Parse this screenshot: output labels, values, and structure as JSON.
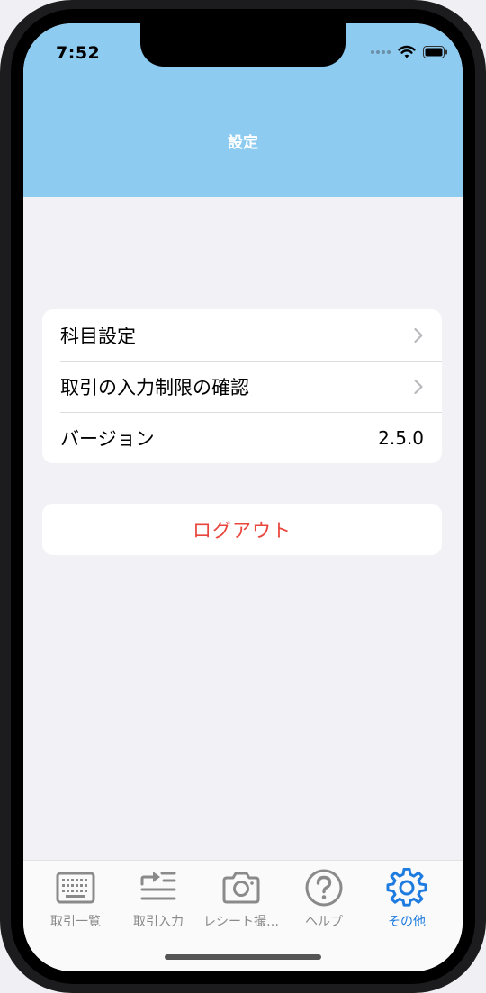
{
  "status_bar": {
    "time": "7:52"
  },
  "nav": {
    "title": "設定"
  },
  "settings": {
    "items": [
      {
        "label": "科目設定"
      },
      {
        "label": "取引の入力制限の確認"
      },
      {
        "label": "バージョン",
        "value": "2.5.0"
      }
    ]
  },
  "logout": {
    "label": "ログアウト"
  },
  "tabbar": {
    "tabs": [
      {
        "label": "取引一覧",
        "icon": "keyboard-icon"
      },
      {
        "label": "取引入力",
        "icon": "list-add-icon"
      },
      {
        "label": "レシート撮…",
        "icon": "camera-icon"
      },
      {
        "label": "ヘルプ",
        "icon": "question-circle-icon"
      },
      {
        "label": "その他",
        "icon": "gear-icon",
        "active": true
      }
    ]
  },
  "colors": {
    "header": "#8ecbf0",
    "logout_text": "#e8453c",
    "active_tab": "#1e7be0",
    "inactive_tab": "#8a8a8a"
  }
}
